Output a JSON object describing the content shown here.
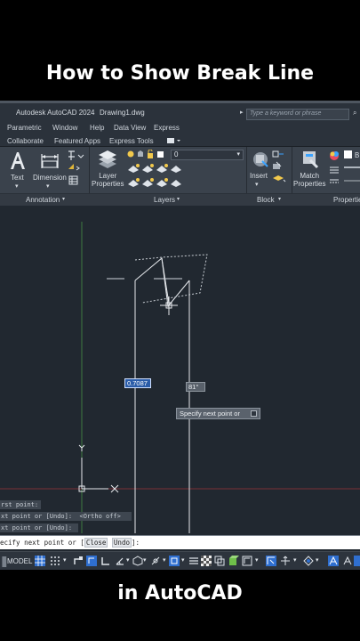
{
  "captions": {
    "top": "How to Show Break Line",
    "bottom": "in AutoCAD"
  },
  "titlebar": {
    "app_title": "Autodesk AutoCAD 2024",
    "file_name": "Drawing1.dwg",
    "search_placeholder": "Type a keyword or phrase"
  },
  "menu": [
    "Parametric",
    "Window",
    "Help",
    "Data View",
    "Express"
  ],
  "ribbon_tabs": [
    "Collaborate",
    "Featured Apps",
    "Express Tools"
  ],
  "ribbon": {
    "text_label": "Text",
    "dimension_label": "Dimension",
    "layer_properties_label": "Layer\nProperties",
    "layer_value": "0",
    "insert_label": "Insert",
    "match_properties_label": "Match\nProperties",
    "color_swatch_text": "B",
    "panels": {
      "annotation": "Annotation",
      "layers": "Layers",
      "block": "Block",
      "properties": "Propertie"
    }
  },
  "drawing": {
    "dynamic_input_value": "0.7087",
    "angle_value": "81°",
    "prompt_tooltip": "Specify next point or",
    "ucs_x": "X",
    "ucs_y": "Y"
  },
  "command_history": [
    "rst point:",
    "xt point or [Undo]:  <Ortho off>",
    "xt point or [Undo]:"
  ],
  "command_input": {
    "prefix": "ecify next point or [",
    "keyword_close": "Close",
    "keyword_undo": "Undo",
    "suffix": "]:"
  },
  "statusbar": {
    "model_label": "MODEL"
  },
  "colors": {
    "canvas_bg": "#212830",
    "ribbon_bg": "#3a424c",
    "accent_blue": "#2a5ca8",
    "axis_green": "#3f7a3f",
    "axis_red": "#7a2f36"
  }
}
